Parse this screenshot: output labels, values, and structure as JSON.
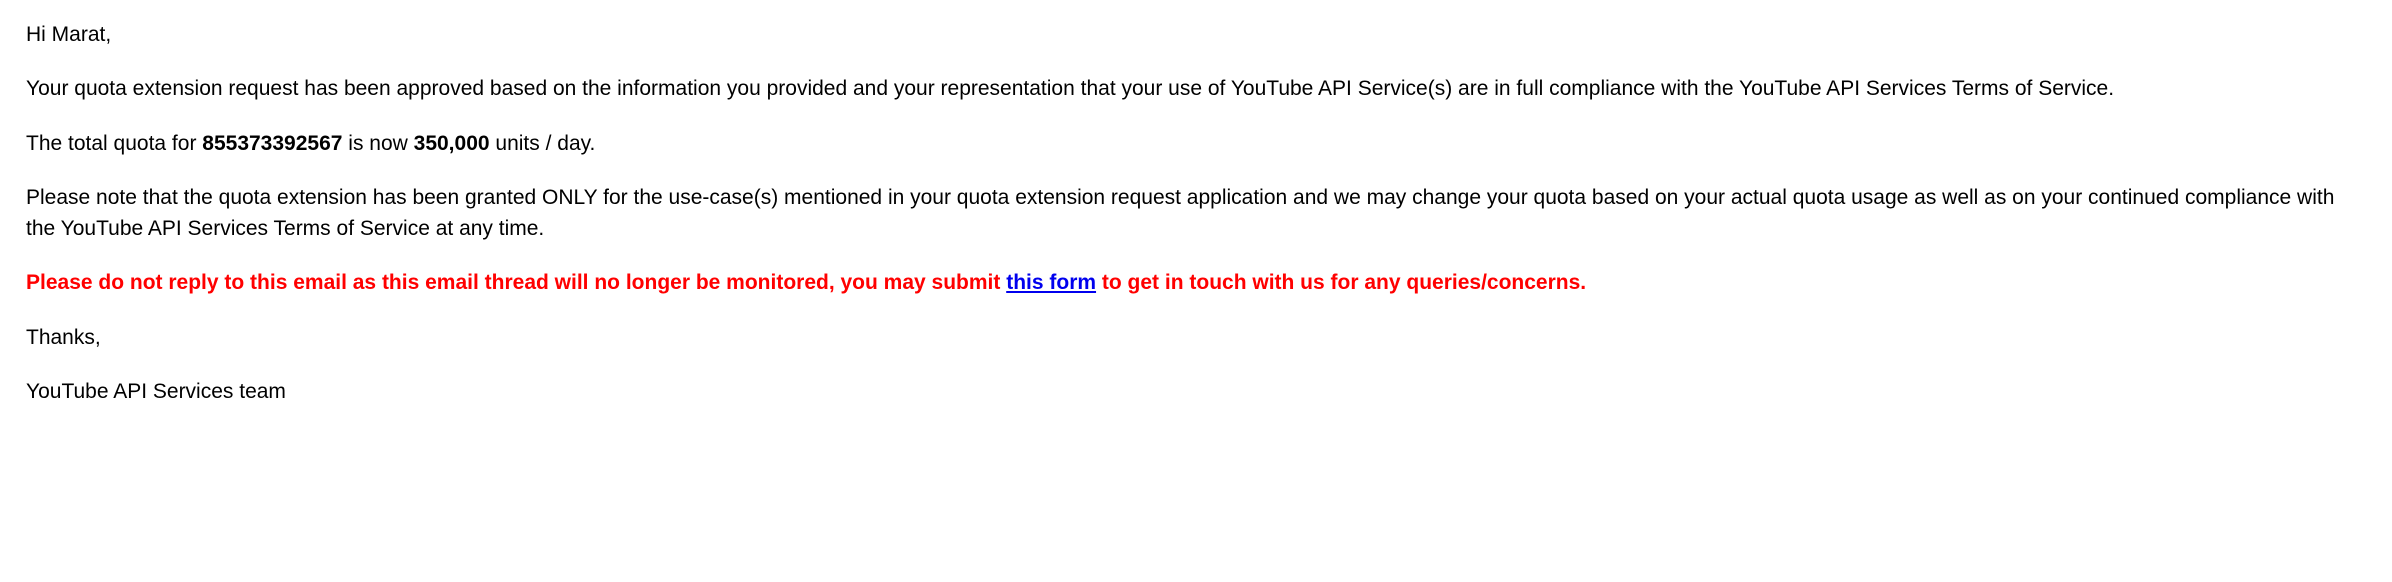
{
  "greeting": "Hi Marat,",
  "para1": "Your quota extension request has been approved based on the information you provided and your representation that your use of YouTube API Service(s) are in full compliance with the YouTube API Services Terms of Service.",
  "quota": {
    "pre": "The total quota for ",
    "project_id": "855373392567",
    "mid": " is now ",
    "amount": "350,000",
    "post": " units / day."
  },
  "para3": "Please note that the quota extension has been granted ONLY for the use-case(s) mentioned in your quota extension request application and we may change your quota based on your actual quota usage as well as on your continued compliance with the YouTube API Services Terms of Service at any time.",
  "warning": {
    "pre": "Please do not reply to this email as this email thread will no longer be monitored, you may submit ",
    "link_text": "this form",
    "post": " to get in touch with us for any queries/concerns."
  },
  "thanks": "Thanks,",
  "signature": "YouTube API Services team"
}
